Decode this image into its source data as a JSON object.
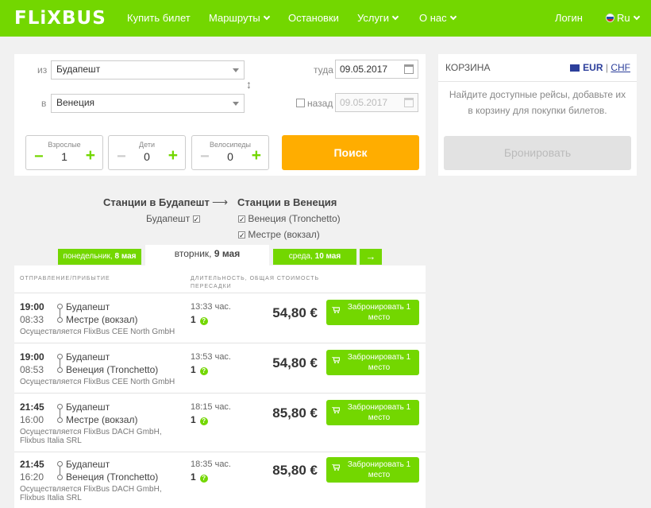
{
  "header": {
    "logo": "FLiXBUS",
    "nav": [
      "Купить билет",
      "Маршруты",
      "Остановки",
      "Услуги",
      "О нас"
    ],
    "login": "Логин",
    "language": "Ru"
  },
  "search": {
    "from_label": "из",
    "from_value": "Будапешт",
    "to_label": "в",
    "to_value": "Венеция",
    "outbound_label": "туда",
    "outbound_date": "09.05.2017",
    "return_label": "назад",
    "return_date": "09.05.2017",
    "passengers": [
      {
        "label": "Взрослые",
        "count": "1"
      },
      {
        "label": "Дети",
        "count": "0"
      },
      {
        "label": "Велосипеды",
        "count": "0"
      }
    ],
    "submit_label": "Поиск"
  },
  "basket": {
    "title": "КОРЗИНА",
    "currency_active": "EUR",
    "currency_sep": "|",
    "currency_other": "CHF",
    "message": "Найдите доступные рейсы, добавьте их в корзину для покупки билетов.",
    "book_label": "Бронировать"
  },
  "stations": {
    "from_heading": "Станции в Будапешт",
    "to_heading": "Станции в Венеция",
    "arrow": "⟶",
    "from_items": [
      "Будапешт"
    ],
    "to_items": [
      "Венеция (Tronchetto)",
      "Местре (вокзал)"
    ]
  },
  "days": {
    "prev": {
      "name": "понедельник, ",
      "date": "8 мая"
    },
    "current": {
      "name": "вторник, ",
      "date": "9 мая"
    },
    "next": {
      "name": "среда, ",
      "date": "10 мая"
    },
    "next_arrow": "→"
  },
  "results": {
    "col_departure": "ОТПРАВЛЕНИЕ/ПРИБЫТИЕ",
    "col_duration": "ДЛИТЕЛЬНОСТЬ, ОБЩАЯ СТОИМОСТЬ ПЕРЕСАДКИ",
    "rows": [
      {
        "dep": "19:00",
        "arr": "08:33",
        "from": "Будапешт",
        "to": "Местре (вокзал)",
        "operator": "Осуществляется FlixBus CEE North GmbH",
        "duration": "13:33 час.",
        "transfers": "1",
        "price": "54,80 €",
        "book": "Забронировать 1 место"
      },
      {
        "dep": "19:00",
        "arr": "08:53",
        "from": "Будапешт",
        "to": "Венеция (Tronchetto)",
        "operator": "Осуществляется FlixBus CEE North GmbH",
        "duration": "13:53 час.",
        "transfers": "1",
        "price": "54,80 €",
        "book": "Забронировать 1 место"
      },
      {
        "dep": "21:45",
        "arr": "16:00",
        "from": "Будапешт",
        "to": "Местре (вокзал)",
        "operator": "Осуществляется FlixBus DACH GmbH,",
        "operator2": "Flixbus Italia SRL",
        "duration": "18:15 час.",
        "transfers": "1",
        "price": "85,80 €",
        "book": "Забронировать 1 место"
      },
      {
        "dep": "21:45",
        "arr": "16:20",
        "from": "Будапешт",
        "to": "Венеция (Tronchetto)",
        "operator": "Осуществляется FlixBus DACH GmbH,",
        "operator2": "Flixbus Italia SRL",
        "duration": "18:35 час.",
        "transfers": "1",
        "price": "85,80 €",
        "book": "Забронировать 1 место"
      }
    ],
    "help_icon": "?"
  },
  "colors": {
    "brand_green": "#73d700",
    "search_orange": "#ffad00"
  }
}
